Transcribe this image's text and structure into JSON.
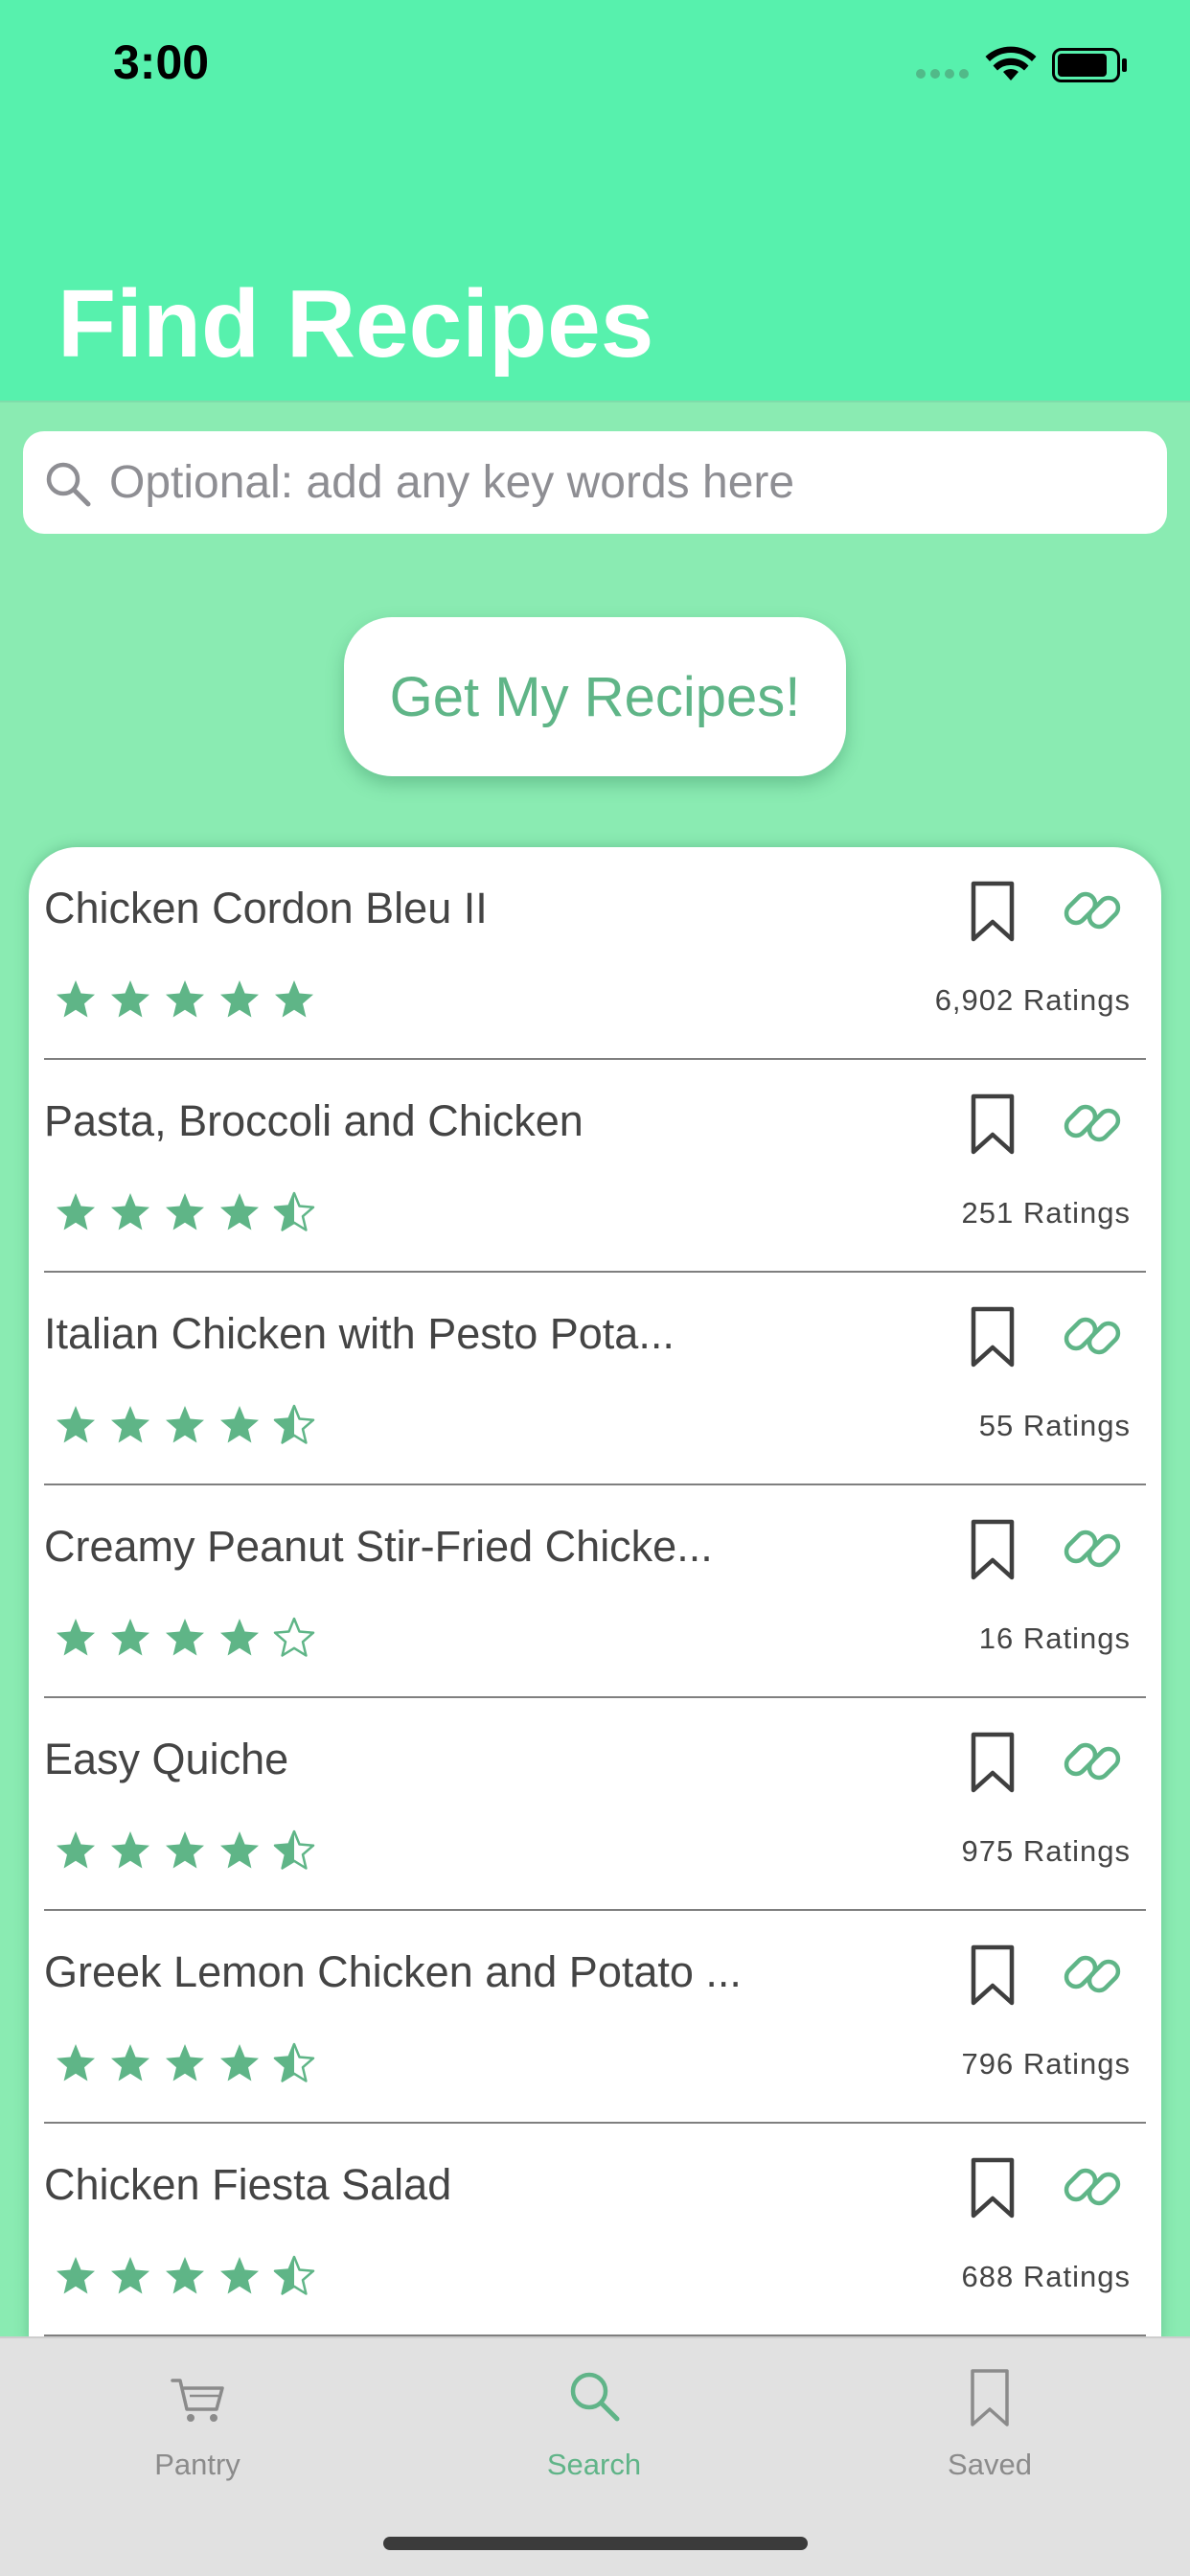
{
  "status_bar": {
    "time": "3:00"
  },
  "header": {
    "title": "Find Recipes"
  },
  "search": {
    "placeholder": "Optional: add any key words here"
  },
  "action_button": {
    "label": "Get My Recipes!"
  },
  "recipes": [
    {
      "title": "Chicken Cordon Bleu II",
      "rating": 5,
      "ratings_text": "6,902 Ratings"
    },
    {
      "title": "Pasta, Broccoli and Chicken",
      "rating": 4.5,
      "ratings_text": "251 Ratings"
    },
    {
      "title": "Italian Chicken with Pesto Pota...",
      "rating": 4.5,
      "ratings_text": "55 Ratings"
    },
    {
      "title": "Creamy Peanut Stir-Fried Chicke...",
      "rating": 4,
      "ratings_text": "16 Ratings"
    },
    {
      "title": "Easy Quiche",
      "rating": 4.5,
      "ratings_text": "975 Ratings"
    },
    {
      "title": "Greek Lemon Chicken and Potato ...",
      "rating": 4.5,
      "ratings_text": "796 Ratings"
    },
    {
      "title": "Chicken Fiesta Salad",
      "rating": 4.5,
      "ratings_text": "688 Ratings"
    }
  ],
  "tab_bar": {
    "tabs": [
      {
        "label": "Pantry",
        "icon": "cart-icon",
        "active": false
      },
      {
        "label": "Search",
        "icon": "magnifier-icon",
        "active": true
      },
      {
        "label": "Saved",
        "icon": "bookmark-icon",
        "active": false
      }
    ]
  },
  "colors": {
    "header_bg": "#57f1ad",
    "content_bg": "#8aebb2",
    "accent": "#60b488",
    "star": "#5fb587",
    "tab_bar_bg": "#e1e1e1"
  }
}
